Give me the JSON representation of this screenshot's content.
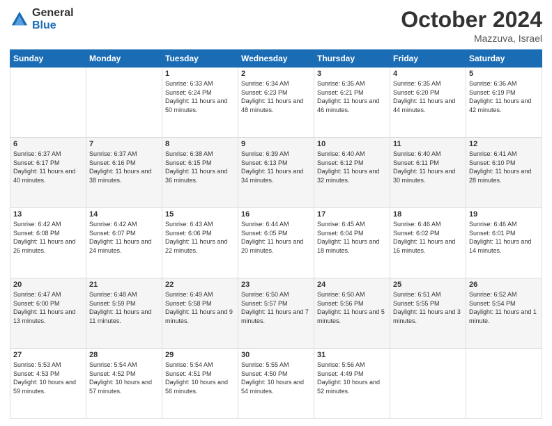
{
  "logo": {
    "general": "General",
    "blue": "Blue"
  },
  "header": {
    "month": "October 2024",
    "location": "Mazzuva, Israel"
  },
  "days_of_week": [
    "Sunday",
    "Monday",
    "Tuesday",
    "Wednesday",
    "Thursday",
    "Friday",
    "Saturday"
  ],
  "weeks": [
    [
      {
        "day": "",
        "info": ""
      },
      {
        "day": "",
        "info": ""
      },
      {
        "day": "1",
        "info": "Sunrise: 6:33 AM\nSunset: 6:24 PM\nDaylight: 11 hours and 50 minutes."
      },
      {
        "day": "2",
        "info": "Sunrise: 6:34 AM\nSunset: 6:23 PM\nDaylight: 11 hours and 48 minutes."
      },
      {
        "day": "3",
        "info": "Sunrise: 6:35 AM\nSunset: 6:21 PM\nDaylight: 11 hours and 46 minutes."
      },
      {
        "day": "4",
        "info": "Sunrise: 6:35 AM\nSunset: 6:20 PM\nDaylight: 11 hours and 44 minutes."
      },
      {
        "day": "5",
        "info": "Sunrise: 6:36 AM\nSunset: 6:19 PM\nDaylight: 11 hours and 42 minutes."
      }
    ],
    [
      {
        "day": "6",
        "info": "Sunrise: 6:37 AM\nSunset: 6:17 PM\nDaylight: 11 hours and 40 minutes."
      },
      {
        "day": "7",
        "info": "Sunrise: 6:37 AM\nSunset: 6:16 PM\nDaylight: 11 hours and 38 minutes."
      },
      {
        "day": "8",
        "info": "Sunrise: 6:38 AM\nSunset: 6:15 PM\nDaylight: 11 hours and 36 minutes."
      },
      {
        "day": "9",
        "info": "Sunrise: 6:39 AM\nSunset: 6:13 PM\nDaylight: 11 hours and 34 minutes."
      },
      {
        "day": "10",
        "info": "Sunrise: 6:40 AM\nSunset: 6:12 PM\nDaylight: 11 hours and 32 minutes."
      },
      {
        "day": "11",
        "info": "Sunrise: 6:40 AM\nSunset: 6:11 PM\nDaylight: 11 hours and 30 minutes."
      },
      {
        "day": "12",
        "info": "Sunrise: 6:41 AM\nSunset: 6:10 PM\nDaylight: 11 hours and 28 minutes."
      }
    ],
    [
      {
        "day": "13",
        "info": "Sunrise: 6:42 AM\nSunset: 6:08 PM\nDaylight: 11 hours and 26 minutes."
      },
      {
        "day": "14",
        "info": "Sunrise: 6:42 AM\nSunset: 6:07 PM\nDaylight: 11 hours and 24 minutes."
      },
      {
        "day": "15",
        "info": "Sunrise: 6:43 AM\nSunset: 6:06 PM\nDaylight: 11 hours and 22 minutes."
      },
      {
        "day": "16",
        "info": "Sunrise: 6:44 AM\nSunset: 6:05 PM\nDaylight: 11 hours and 20 minutes."
      },
      {
        "day": "17",
        "info": "Sunrise: 6:45 AM\nSunset: 6:04 PM\nDaylight: 11 hours and 18 minutes."
      },
      {
        "day": "18",
        "info": "Sunrise: 6:46 AM\nSunset: 6:02 PM\nDaylight: 11 hours and 16 minutes."
      },
      {
        "day": "19",
        "info": "Sunrise: 6:46 AM\nSunset: 6:01 PM\nDaylight: 11 hours and 14 minutes."
      }
    ],
    [
      {
        "day": "20",
        "info": "Sunrise: 6:47 AM\nSunset: 6:00 PM\nDaylight: 11 hours and 13 minutes."
      },
      {
        "day": "21",
        "info": "Sunrise: 6:48 AM\nSunset: 5:59 PM\nDaylight: 11 hours and 11 minutes."
      },
      {
        "day": "22",
        "info": "Sunrise: 6:49 AM\nSunset: 5:58 PM\nDaylight: 11 hours and 9 minutes."
      },
      {
        "day": "23",
        "info": "Sunrise: 6:50 AM\nSunset: 5:57 PM\nDaylight: 11 hours and 7 minutes."
      },
      {
        "day": "24",
        "info": "Sunrise: 6:50 AM\nSunset: 5:56 PM\nDaylight: 11 hours and 5 minutes."
      },
      {
        "day": "25",
        "info": "Sunrise: 6:51 AM\nSunset: 5:55 PM\nDaylight: 11 hours and 3 minutes."
      },
      {
        "day": "26",
        "info": "Sunrise: 6:52 AM\nSunset: 5:54 PM\nDaylight: 11 hours and 1 minute."
      }
    ],
    [
      {
        "day": "27",
        "info": "Sunrise: 5:53 AM\nSunset: 4:53 PM\nDaylight: 10 hours and 59 minutes."
      },
      {
        "day": "28",
        "info": "Sunrise: 5:54 AM\nSunset: 4:52 PM\nDaylight: 10 hours and 57 minutes."
      },
      {
        "day": "29",
        "info": "Sunrise: 5:54 AM\nSunset: 4:51 PM\nDaylight: 10 hours and 56 minutes."
      },
      {
        "day": "30",
        "info": "Sunrise: 5:55 AM\nSunset: 4:50 PM\nDaylight: 10 hours and 54 minutes."
      },
      {
        "day": "31",
        "info": "Sunrise: 5:56 AM\nSunset: 4:49 PM\nDaylight: 10 hours and 52 minutes."
      },
      {
        "day": "",
        "info": ""
      },
      {
        "day": "",
        "info": ""
      }
    ]
  ]
}
